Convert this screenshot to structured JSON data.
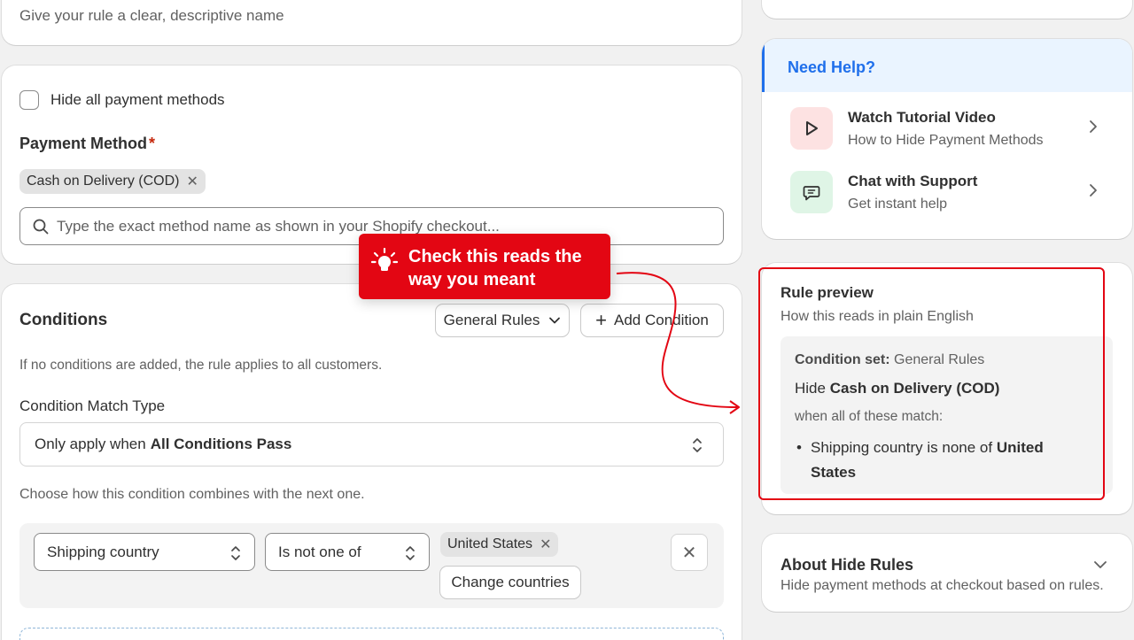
{
  "name_card": {
    "hint": "Give your rule a clear, descriptive name"
  },
  "payment": {
    "hide_all_label": "Hide all payment methods",
    "field_title": "Payment Method",
    "required_mark": "*",
    "selected_tag": "Cash on Delivery (COD)",
    "search_placeholder": "Type the exact method name as shown in your Shopify checkout..."
  },
  "conditions": {
    "title": "Conditions",
    "general_rules_label": "General Rules",
    "add_condition_label": "Add Condition",
    "description": "If no conditions are added, the rule applies to all customers.",
    "match_type_label": "Condition Match Type",
    "match_prefix": "Only apply when ",
    "match_value": "All Conditions Pass",
    "combine_hint": "Choose how this condition combines with the next one.",
    "row": {
      "field": "Shipping country",
      "operator": "Is not one of",
      "value_tag": "United States",
      "change_label": "Change countries"
    }
  },
  "help": {
    "title": "Need Help?",
    "items": [
      {
        "title": "Watch Tutorial Video",
        "subtitle": "How to Hide Payment Methods",
        "icon": "play-icon",
        "color": "#fde2e2"
      },
      {
        "title": "Chat with Support",
        "subtitle": "Get instant help",
        "icon": "chat-icon",
        "color": "#dff5e6"
      }
    ]
  },
  "preview": {
    "title": "Rule preview",
    "subtitle": "How this reads in plain English",
    "set_label": "Condition set:",
    "set_value": " General Rules",
    "hide_prefix": "Hide ",
    "hide_value": "Cash on Delivery (COD)",
    "when_text": "when all of these match:",
    "bullet_prefix": "Shipping country is none of ",
    "bullet_value": "United States"
  },
  "about": {
    "title": "About Hide Rules",
    "subtitle": "Hide payment methods at checkout based on rules."
  },
  "callout": {
    "text": "Check this reads the way you meant",
    "color": "#e30613",
    "icon": "lightbulb-icon"
  },
  "colors": {
    "accent": "#1f6feb",
    "highlight": "#e30613"
  }
}
